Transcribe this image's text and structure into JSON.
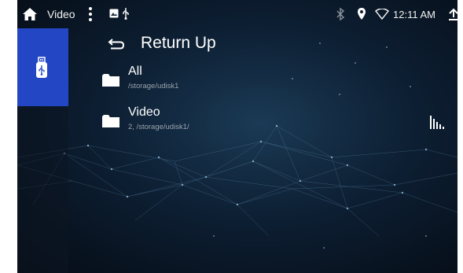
{
  "status_bar": {
    "app_title": "Video",
    "time": "12:11 AM",
    "icons": [
      "home-icon",
      "menu-dots-icon",
      "image-notification-icon",
      "usb-notification-icon",
      "bluetooth-icon",
      "location-icon",
      "wifi-icon",
      "upload-icon"
    ]
  },
  "sidebar": {
    "items": [
      {
        "icon": "usb-drive-icon",
        "selected": true
      }
    ]
  },
  "browser": {
    "return_label": "Return Up",
    "entries": [
      {
        "name": "All",
        "path": "/storage/udisk1",
        "icon": "folder-icon"
      },
      {
        "name": "Video",
        "path": "2, /storage/udisk1/",
        "icon": "folder-icon"
      }
    ]
  },
  "equalizer": {
    "icon": "equalizer-icon"
  },
  "colors": {
    "sidebar_selected": "#2346c4",
    "background": "#0a1626",
    "text": "#ffffff",
    "subtext": "#9aa3ad"
  }
}
